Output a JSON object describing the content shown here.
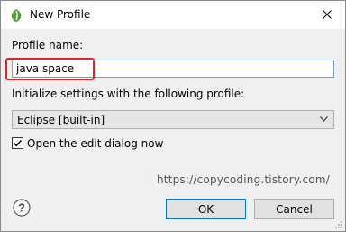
{
  "window": {
    "title": "New Profile",
    "icon": "eclipse-logo-icon",
    "close_icon": "close-icon"
  },
  "form": {
    "profile_name_label": "Profile name:",
    "profile_name_value": "java space",
    "init_label": "Initialize settings with the following profile:",
    "profile_select_value": "Eclipse [built-in]",
    "open_dialog_label": "Open the edit dialog now",
    "open_dialog_checked": true
  },
  "watermark": "https://copycoding.tistory.com/",
  "buttons": {
    "ok": "OK",
    "cancel": "Cancel"
  },
  "colors": {
    "highlight_box": "#e8202a",
    "focus_border": "#7a9cd3"
  }
}
